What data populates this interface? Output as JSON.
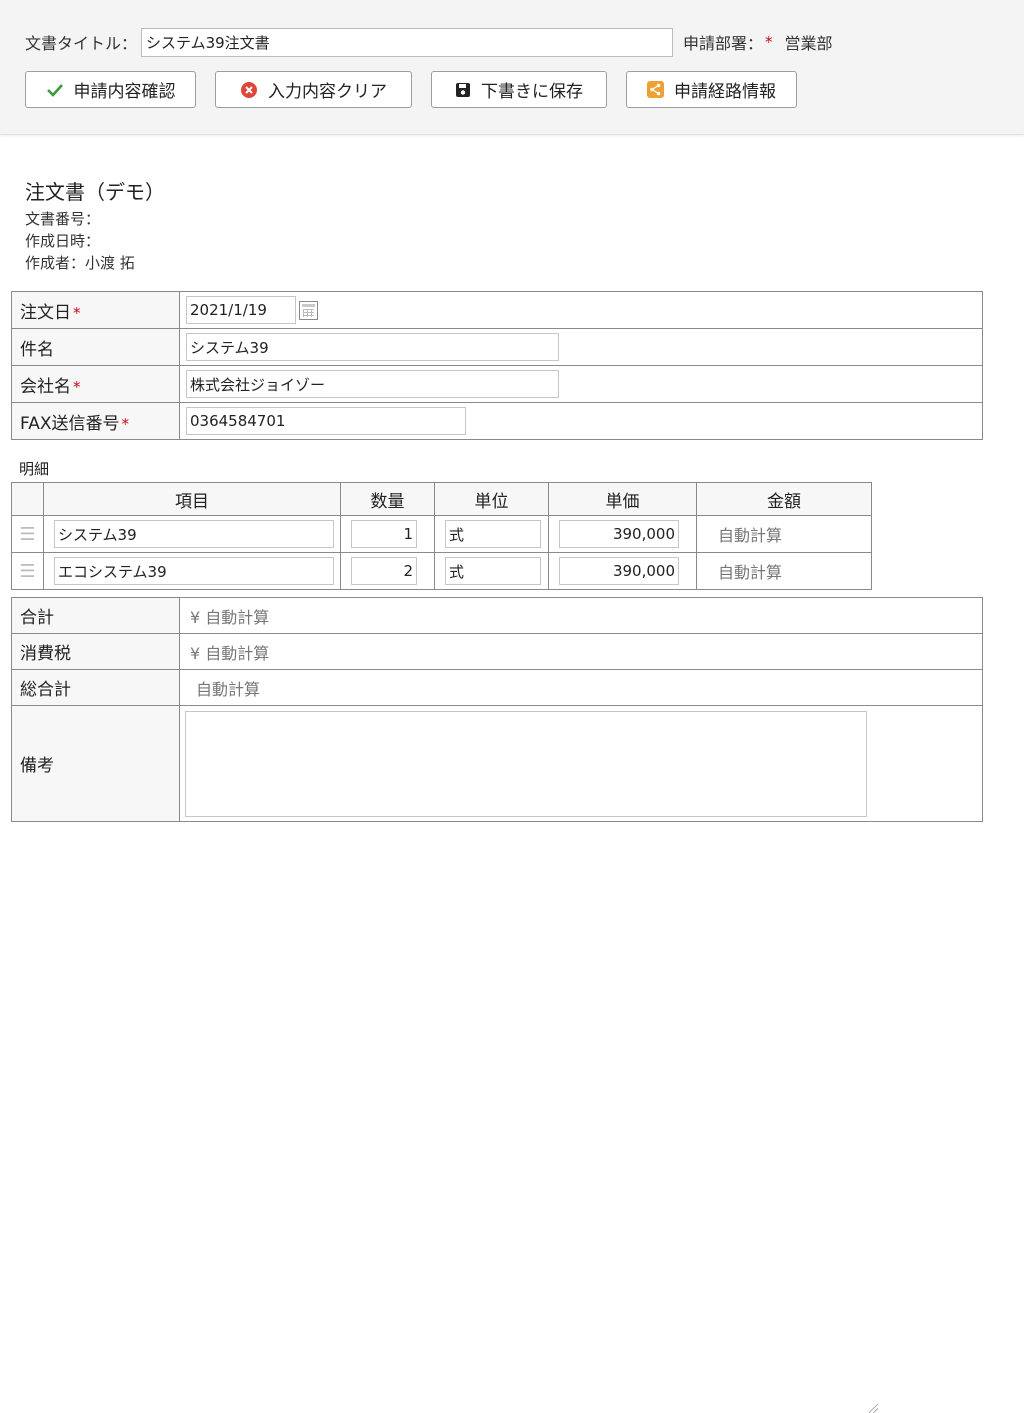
{
  "header": {
    "title_label": "文書タイトル：",
    "title_value": "システム39注文書",
    "dept_label": "申請部署：",
    "required_mark": "*",
    "dept_value": "営業部",
    "buttons": {
      "confirm": "申請内容確認",
      "clear": "入力内容クリア",
      "save_draft": "下書きに保存",
      "route_info": "申請経路情報"
    }
  },
  "document": {
    "title": "注文書（デモ）",
    "number_label": "文書番号：",
    "created_label": "作成日時：",
    "author_label": "作成者：小渡 拓"
  },
  "form": {
    "order_date_label": "注文日",
    "order_date_value": "2021/1/19",
    "subject_label": "件名",
    "subject_value": "システム39",
    "company_label": "会社名",
    "company_value": "株式会社ジョイゾー",
    "fax_label": "FAX送信番号",
    "fax_value": "0364584701"
  },
  "details": {
    "section_label": "明細",
    "columns": {
      "item": "項目",
      "qty": "数量",
      "unit": "単位",
      "price": "単価",
      "amount": "金額"
    },
    "rows": [
      {
        "item": "システム39",
        "qty": "1",
        "unit": "式",
        "price": "390,000",
        "amount": "自動計算"
      },
      {
        "item": "エコシステム39",
        "qty": "2",
        "unit": "式",
        "price": "390,000",
        "amount": "自動計算"
      }
    ]
  },
  "totals": {
    "subtotal_label": "合計",
    "subtotal_value": "¥ 自動計算",
    "tax_label": "消費税",
    "tax_value": "¥ 自動計算",
    "grand_label": "総合計",
    "grand_value": "自動計算",
    "remarks_label": "備考",
    "remarks_value": ""
  },
  "colors": {
    "required": "#d0021b",
    "check_green": "#3b9b3b",
    "clear_red": "#e0453a",
    "route_orange": "#f0a030"
  }
}
